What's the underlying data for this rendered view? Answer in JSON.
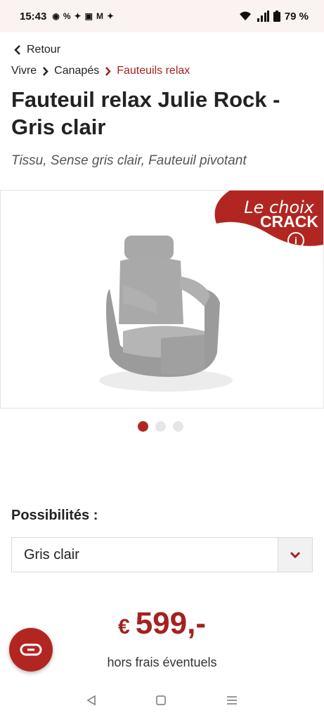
{
  "status_bar": {
    "time": "15:43",
    "notification_icons": [
      "messenger-icon",
      "percent-icon",
      "maple-leaf-icon",
      "card-icon",
      "gmail-icon",
      "maple-leaf-icon"
    ],
    "battery": "79 %"
  },
  "nav": {
    "back_label": "Retour"
  },
  "breadcrumb": {
    "items": [
      "Vivre",
      "Canapés",
      "Fauteuils relax"
    ]
  },
  "product": {
    "title": "Fauteuil relax Julie Rock - Gris clair",
    "subtitle": "Tissu, Sense gris clair, Fauteuil pivotant",
    "badge_line1": "Le choix",
    "badge_line2": "CRACK",
    "image_count": 3,
    "active_image": 1
  },
  "options": {
    "label": "Possibilités :",
    "selected": "Gris clair"
  },
  "price": {
    "currency": "€",
    "amount": "599,-",
    "note": "hors frais éventuels"
  },
  "colors": {
    "accent": "#a3221f",
    "badge": "#b22622",
    "status_bar_bg": "#faf3f2"
  }
}
